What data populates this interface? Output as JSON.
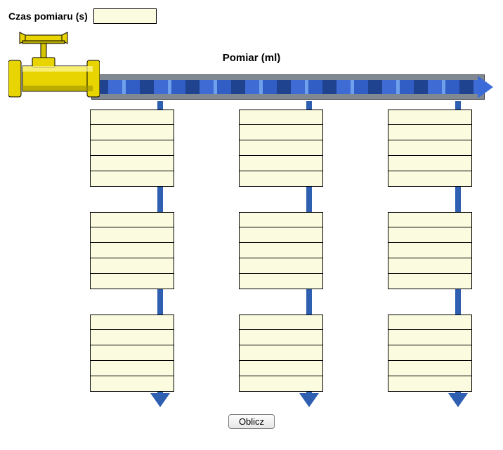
{
  "time": {
    "label": "Czas pomiaru (s)",
    "value": "",
    "placeholder": ""
  },
  "main": {
    "section_title": "Pomiar (ml)"
  },
  "columns": [
    {
      "groups": [
        {
          "cells": [
            "",
            "",
            "",
            "",
            ""
          ]
        },
        {
          "cells": [
            "",
            "",
            "",
            "",
            ""
          ]
        },
        {
          "cells": [
            "",
            "",
            "",
            "",
            ""
          ]
        }
      ]
    },
    {
      "groups": [
        {
          "cells": [
            "",
            "",
            "",
            "",
            ""
          ]
        },
        {
          "cells": [
            "",
            "",
            "",
            "",
            ""
          ]
        },
        {
          "cells": [
            "",
            "",
            "",
            "",
            ""
          ]
        }
      ]
    },
    {
      "groups": [
        {
          "cells": [
            "",
            "",
            "",
            "",
            ""
          ]
        },
        {
          "cells": [
            "",
            "",
            "",
            "",
            ""
          ]
        },
        {
          "cells": [
            "",
            "",
            "",
            "",
            ""
          ]
        }
      ]
    }
  ],
  "buttons": {
    "calculate": "Oblicz"
  },
  "colors": {
    "cell_bg": "#fbfbdf",
    "arrow": "#2f5fb0",
    "faucet": "#e8d400",
    "pipe": "#808891"
  }
}
